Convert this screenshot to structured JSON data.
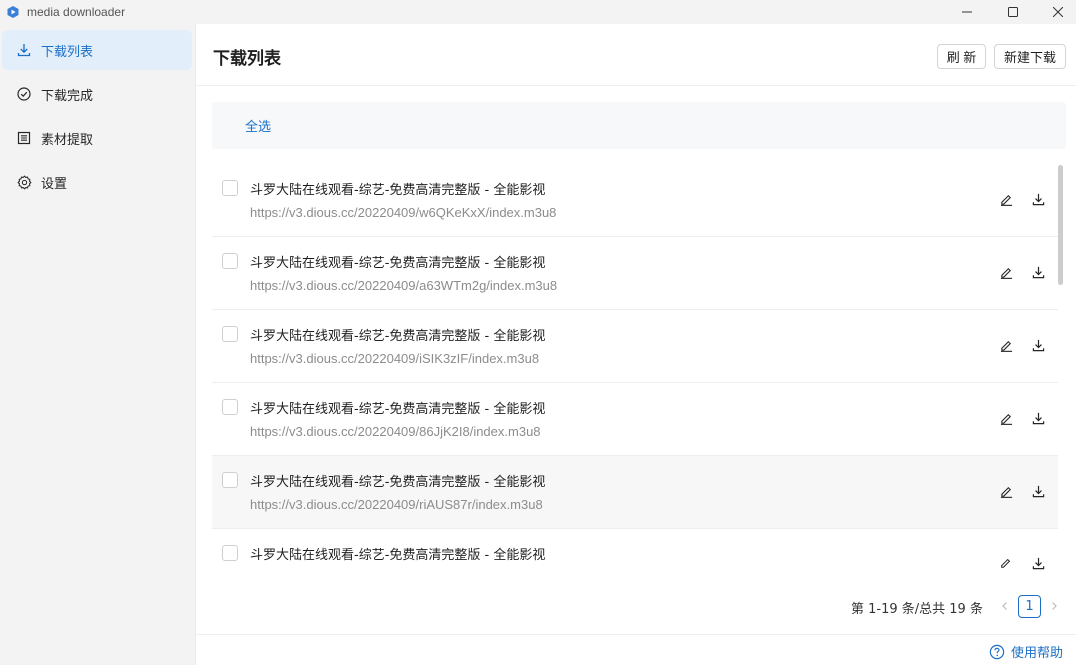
{
  "window": {
    "title": "media downloader",
    "icons": [
      "app-logo-icon",
      "minimize-icon",
      "maximize-icon",
      "close-icon"
    ]
  },
  "sidebar": {
    "items": [
      {
        "label": "下载列表",
        "icon": "download-icon",
        "active": true
      },
      {
        "label": "下载完成",
        "icon": "check-circle-icon",
        "active": false
      },
      {
        "label": "素材提取",
        "icon": "list-document-icon",
        "active": false
      },
      {
        "label": "设置",
        "icon": "gear-icon",
        "active": false
      }
    ]
  },
  "main": {
    "title": "下载列表",
    "refresh_label": "刷 新",
    "new_download_label": "新建下载",
    "select_all_label": "全选"
  },
  "rows": [
    {
      "title": "斗罗大陆在线观看-综艺-免费高清完整版 - 全能影视",
      "url": "https://v3.dious.cc/20220409/w6QKeKxX/index.m3u8"
    },
    {
      "title": "斗罗大陆在线观看-综艺-免费高清完整版 - 全能影视",
      "url": "https://v3.dious.cc/20220409/a63WTm2g/index.m3u8"
    },
    {
      "title": "斗罗大陆在线观看-综艺-免费高清完整版 - 全能影视",
      "url": "https://v3.dious.cc/20220409/iSIK3zIF/index.m3u8"
    },
    {
      "title": "斗罗大陆在线观看-综艺-免费高清完整版 - 全能影视",
      "url": "https://v3.dious.cc/20220409/86JjK2I8/index.m3u8"
    },
    {
      "title": "斗罗大陆在线观看-综艺-免费高清完整版 - 全能影视",
      "url": "https://v3.dious.cc/20220409/riAUS87r/index.m3u8"
    },
    {
      "title": "斗罗大陆在线观看-综艺-免费高清完整版 - 全能影视",
      "url": ""
    }
  ],
  "row_icons": [
    "edit-icon",
    "download-icon"
  ],
  "pagination": {
    "info": "第 1-19 条/总共 19 条",
    "current_page": "1"
  },
  "footer": {
    "help_label": "使用帮助",
    "help_icon": "question-circle-icon"
  },
  "colors": {
    "accent": "#1a6fc7",
    "active_bg": "#e3eefb",
    "sidebar_bg": "#f3f3f3"
  }
}
